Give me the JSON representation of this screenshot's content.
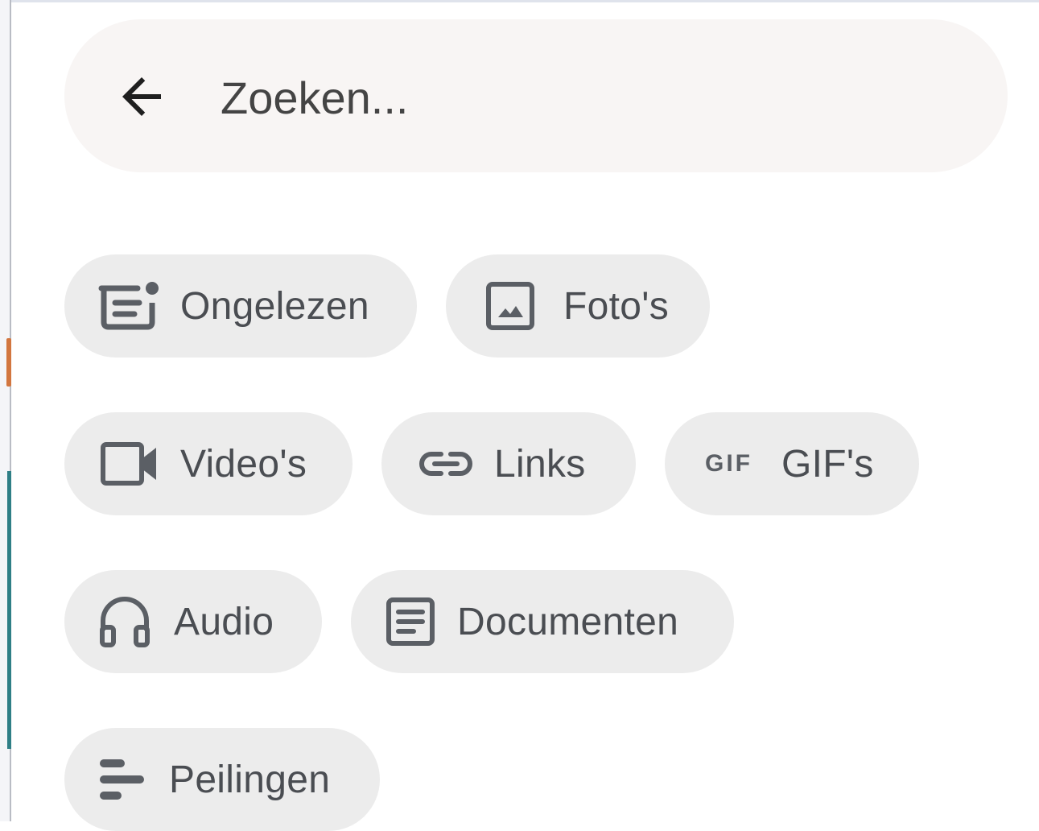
{
  "search": {
    "placeholder": "Zoeken..."
  },
  "filters": [
    {
      "label": "Ongelezen",
      "icon": "unread-icon"
    },
    {
      "label": "Foto's",
      "icon": "photo-icon"
    },
    {
      "label": "Video's",
      "icon": "video-icon"
    },
    {
      "label": "Links",
      "icon": "link-icon"
    },
    {
      "label": "GIF's",
      "icon": "gif-icon"
    },
    {
      "label": "Audio",
      "icon": "headphones-icon"
    },
    {
      "label": "Documenten",
      "icon": "document-icon"
    },
    {
      "label": "Peilingen",
      "icon": "poll-icon"
    }
  ],
  "gif_icon_text": "GIF",
  "colors": {
    "search_bg": "#f8f5f4",
    "chip_bg": "#ececec",
    "chip_text": "#4a4d52",
    "icon": "#5b5f65"
  }
}
